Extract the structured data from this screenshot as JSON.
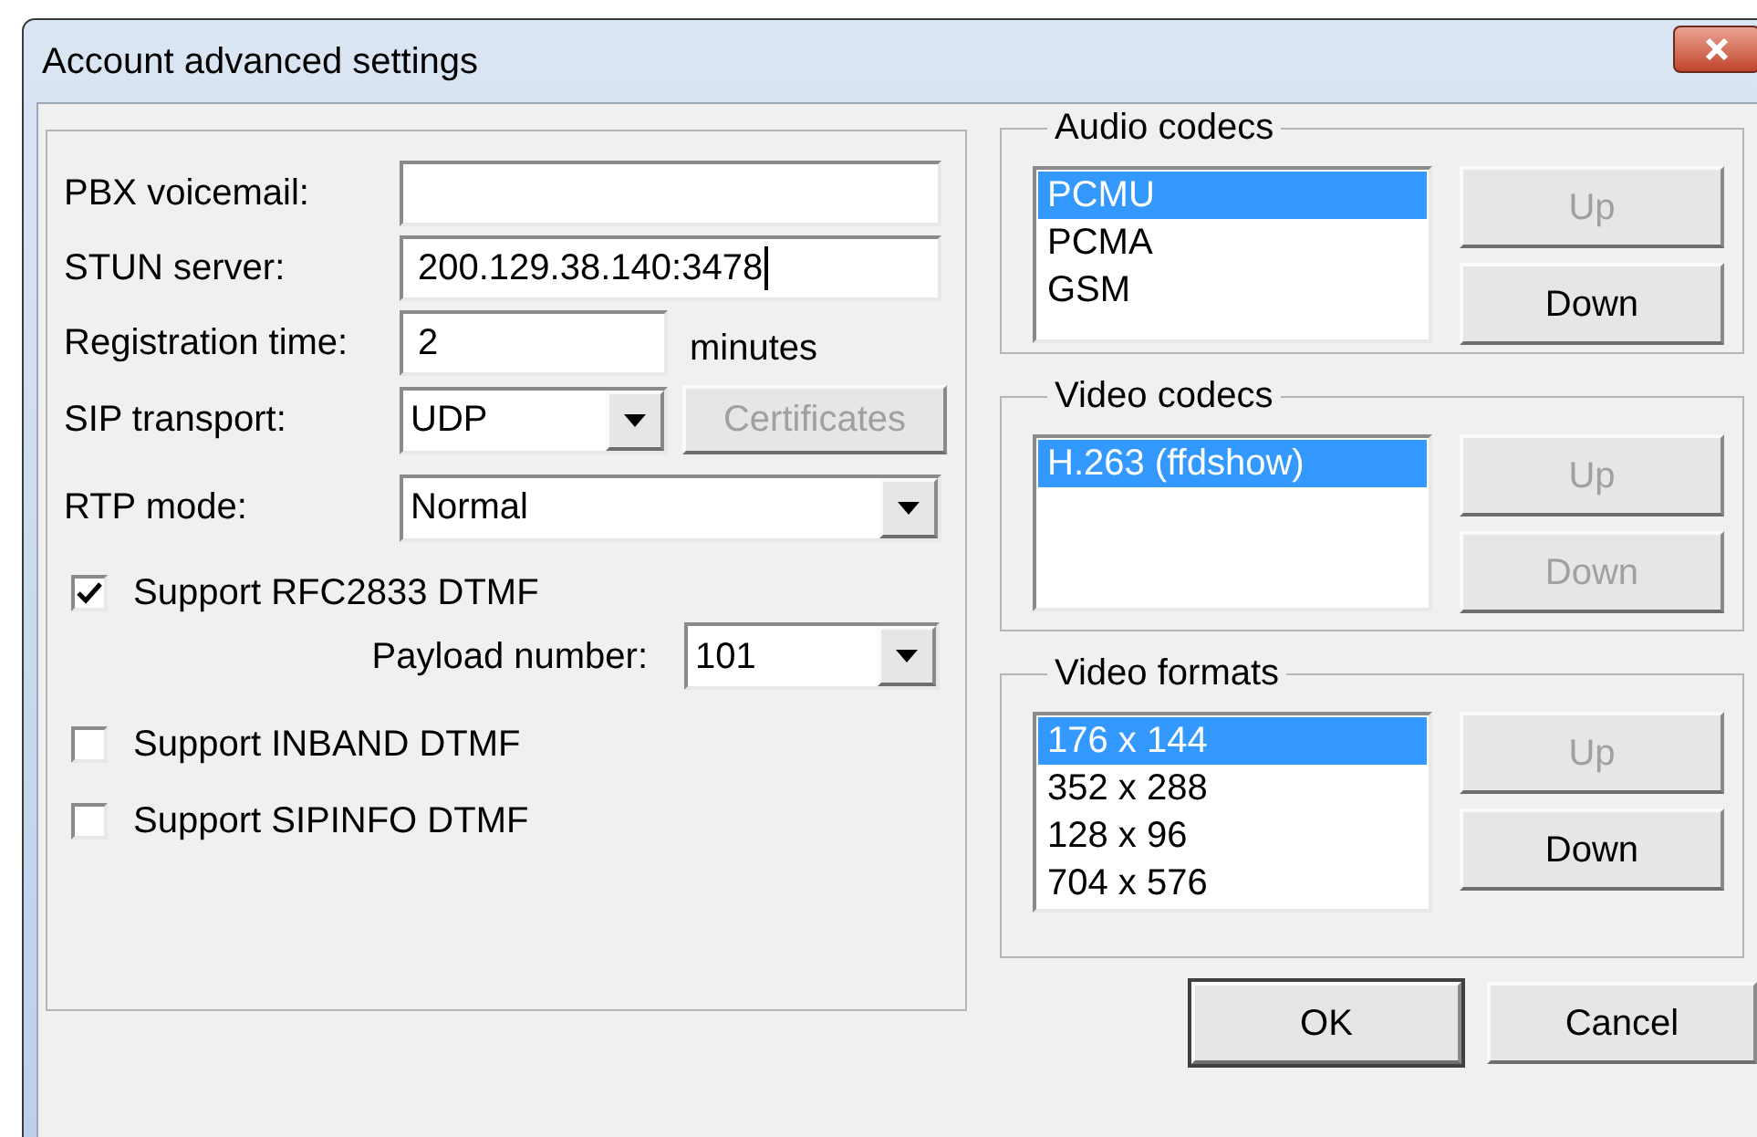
{
  "window": {
    "title": "Account advanced settings"
  },
  "fields": [
    {
      "kind": "text",
      "label": "PBX voicemail:",
      "focused": false
    },
    {
      "kind": "text",
      "label": "STUN server:",
      "value": "200.129.38.140:3478",
      "focused": true
    },
    {
      "kind": "short",
      "label": "Registration time:",
      "value": "2",
      "suffix": "minutes",
      "focused": false
    },
    {
      "kind": "select-button",
      "label": "SIP transport:",
      "value": "UDP",
      "button": {
        "label": "Certificates",
        "disabled": true
      }
    },
    {
      "kind": "select",
      "label": "RTP mode:",
      "value": "Normal"
    }
  ],
  "checkboxes": [
    {
      "label": "Support RFC2833 DTMF",
      "checked": true,
      "payload": {
        "label": "Payload number:",
        "value": "101"
      }
    },
    {
      "label": "Support INBAND DTMF",
      "checked": false
    },
    {
      "label": "Support SIPINFO DTMF",
      "checked": false
    }
  ],
  "groups": [
    {
      "title": "Audio codecs",
      "items": [
        {
          "label": "PCMU",
          "selected": true
        },
        {
          "label": "PCMA",
          "selected": false
        },
        {
          "label": "GSM",
          "selected": false
        }
      ],
      "buttons": [
        {
          "label": "Up",
          "disabled": true
        },
        {
          "label": "Down",
          "disabled": false
        }
      ]
    },
    {
      "title": "Video codecs",
      "items": [
        {
          "label": "H.263 (ffdshow)",
          "selected": true
        }
      ],
      "buttons": [
        {
          "label": "Up",
          "disabled": true
        },
        {
          "label": "Down",
          "disabled": true
        }
      ]
    },
    {
      "title": "Video formats",
      "items": [
        {
          "label": "176 x 144",
          "selected": true
        },
        {
          "label": "352 x 288",
          "selected": false
        },
        {
          "label": "128 x 96",
          "selected": false
        },
        {
          "label": "704 x 576",
          "selected": false
        }
      ],
      "buttons": [
        {
          "label": "Up",
          "disabled": true
        },
        {
          "label": "Down",
          "disabled": false
        }
      ]
    }
  ],
  "buttons": [
    {
      "label": "OK",
      "default": true
    },
    {
      "label": "Cancel",
      "default": false
    }
  ]
}
